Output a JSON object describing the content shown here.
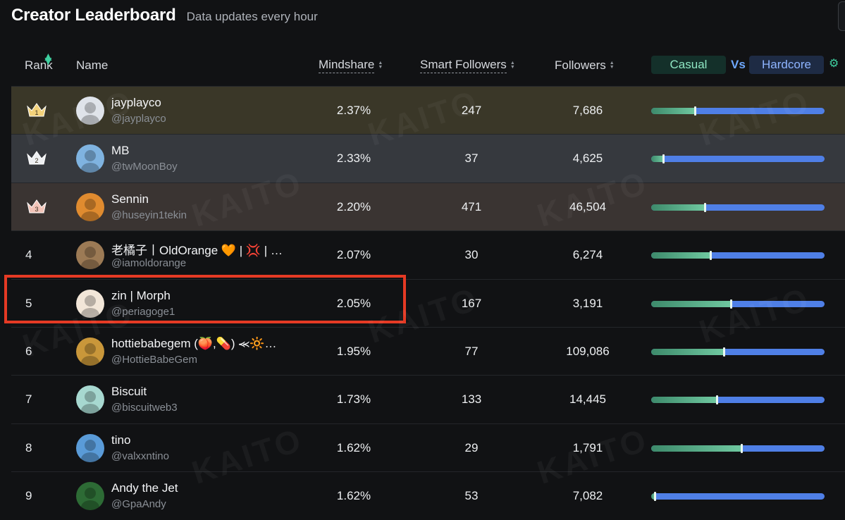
{
  "header": {
    "title": "Creator Leaderboard",
    "subtitle": "Data updates every hour"
  },
  "columns": {
    "rank": "Rank",
    "name": "Name",
    "mindshare": "Mindshare",
    "smart_followers": "Smart Followers",
    "followers": "Followers",
    "casual": "Casual",
    "vs": "Vs",
    "hardcore": "Hardcore"
  },
  "watermark": "KAITO",
  "colors": {
    "accent_green": "#3fd0a0",
    "casual_green": "#6fc8a0",
    "hardcore_blue": "#4f7fe6",
    "highlight_red": "#e53a24",
    "rank1_bg": "#3a3728",
    "rank2_bg": "#36393e",
    "rank3_bg": "#3a3432"
  },
  "rows": [
    {
      "rank": "1",
      "name": "jayplayco",
      "handle": "@jayplayco",
      "mindshare": "2.37%",
      "smart_followers": "247",
      "followers": "7,686",
      "casual_ratio": 0.25,
      "avatar_color": "#dfe3ea",
      "avatar_icon": "avatar-jayplayco"
    },
    {
      "rank": "2",
      "name": "MB",
      "handle": "@twMoonBoy",
      "mindshare": "2.33%",
      "smart_followers": "37",
      "followers": "4,625",
      "casual_ratio": 0.07,
      "avatar_color": "#7fb3e0",
      "avatar_icon": "avatar-mb"
    },
    {
      "rank": "3",
      "name": "Sennin",
      "handle": "@huseyin1tekin",
      "mindshare": "2.20%",
      "smart_followers": "471",
      "followers": "46,504",
      "casual_ratio": 0.31,
      "avatar_color": "#e08b2f",
      "avatar_icon": "avatar-sennin"
    },
    {
      "rank": "4",
      "name": "老橘子丨OldOrange 🧡 | 💢 | …",
      "handle": "@iamoldorange",
      "mindshare": "2.07%",
      "smart_followers": "30",
      "followers": "6,274",
      "casual_ratio": 0.34,
      "avatar_color": "#9c7a55",
      "avatar_icon": "avatar-oldorange"
    },
    {
      "rank": "5",
      "name": "zin | Morph",
      "handle": "@periagoge1",
      "mindshare": "2.05%",
      "smart_followers": "167",
      "followers": "3,191",
      "casual_ratio": 0.46,
      "avatar_color": "#f2e6d8",
      "avatar_icon": "avatar-zin"
    },
    {
      "rank": "6",
      "name": "hottiebabegem (🍑,💊) ⪻🔆…",
      "handle": "@HottieBabeGem",
      "mindshare": "1.95%",
      "smart_followers": "77",
      "followers": "109,086",
      "casual_ratio": 0.42,
      "avatar_color": "#c9973a",
      "avatar_icon": "avatar-hottie"
    },
    {
      "rank": "7",
      "name": "Biscuit",
      "handle": "@biscuitweb3",
      "mindshare": "1.73%",
      "smart_followers": "133",
      "followers": "14,445",
      "casual_ratio": 0.38,
      "avatar_color": "#a7d8d0",
      "avatar_icon": "avatar-biscuit"
    },
    {
      "rank": "8",
      "name": "tino",
      "handle": "@valxxntino",
      "mindshare": "1.62%",
      "smart_followers": "29",
      "followers": "1,791",
      "casual_ratio": 0.52,
      "avatar_color": "#5a9bd8",
      "avatar_icon": "avatar-tino"
    },
    {
      "rank": "9",
      "name": "Andy the Jet",
      "handle": "@GpaAndy",
      "mindshare": "1.62%",
      "smart_followers": "53",
      "followers": "7,082",
      "casual_ratio": 0.02,
      "avatar_color": "#2d6b35",
      "avatar_icon": "avatar-andy"
    }
  ]
}
